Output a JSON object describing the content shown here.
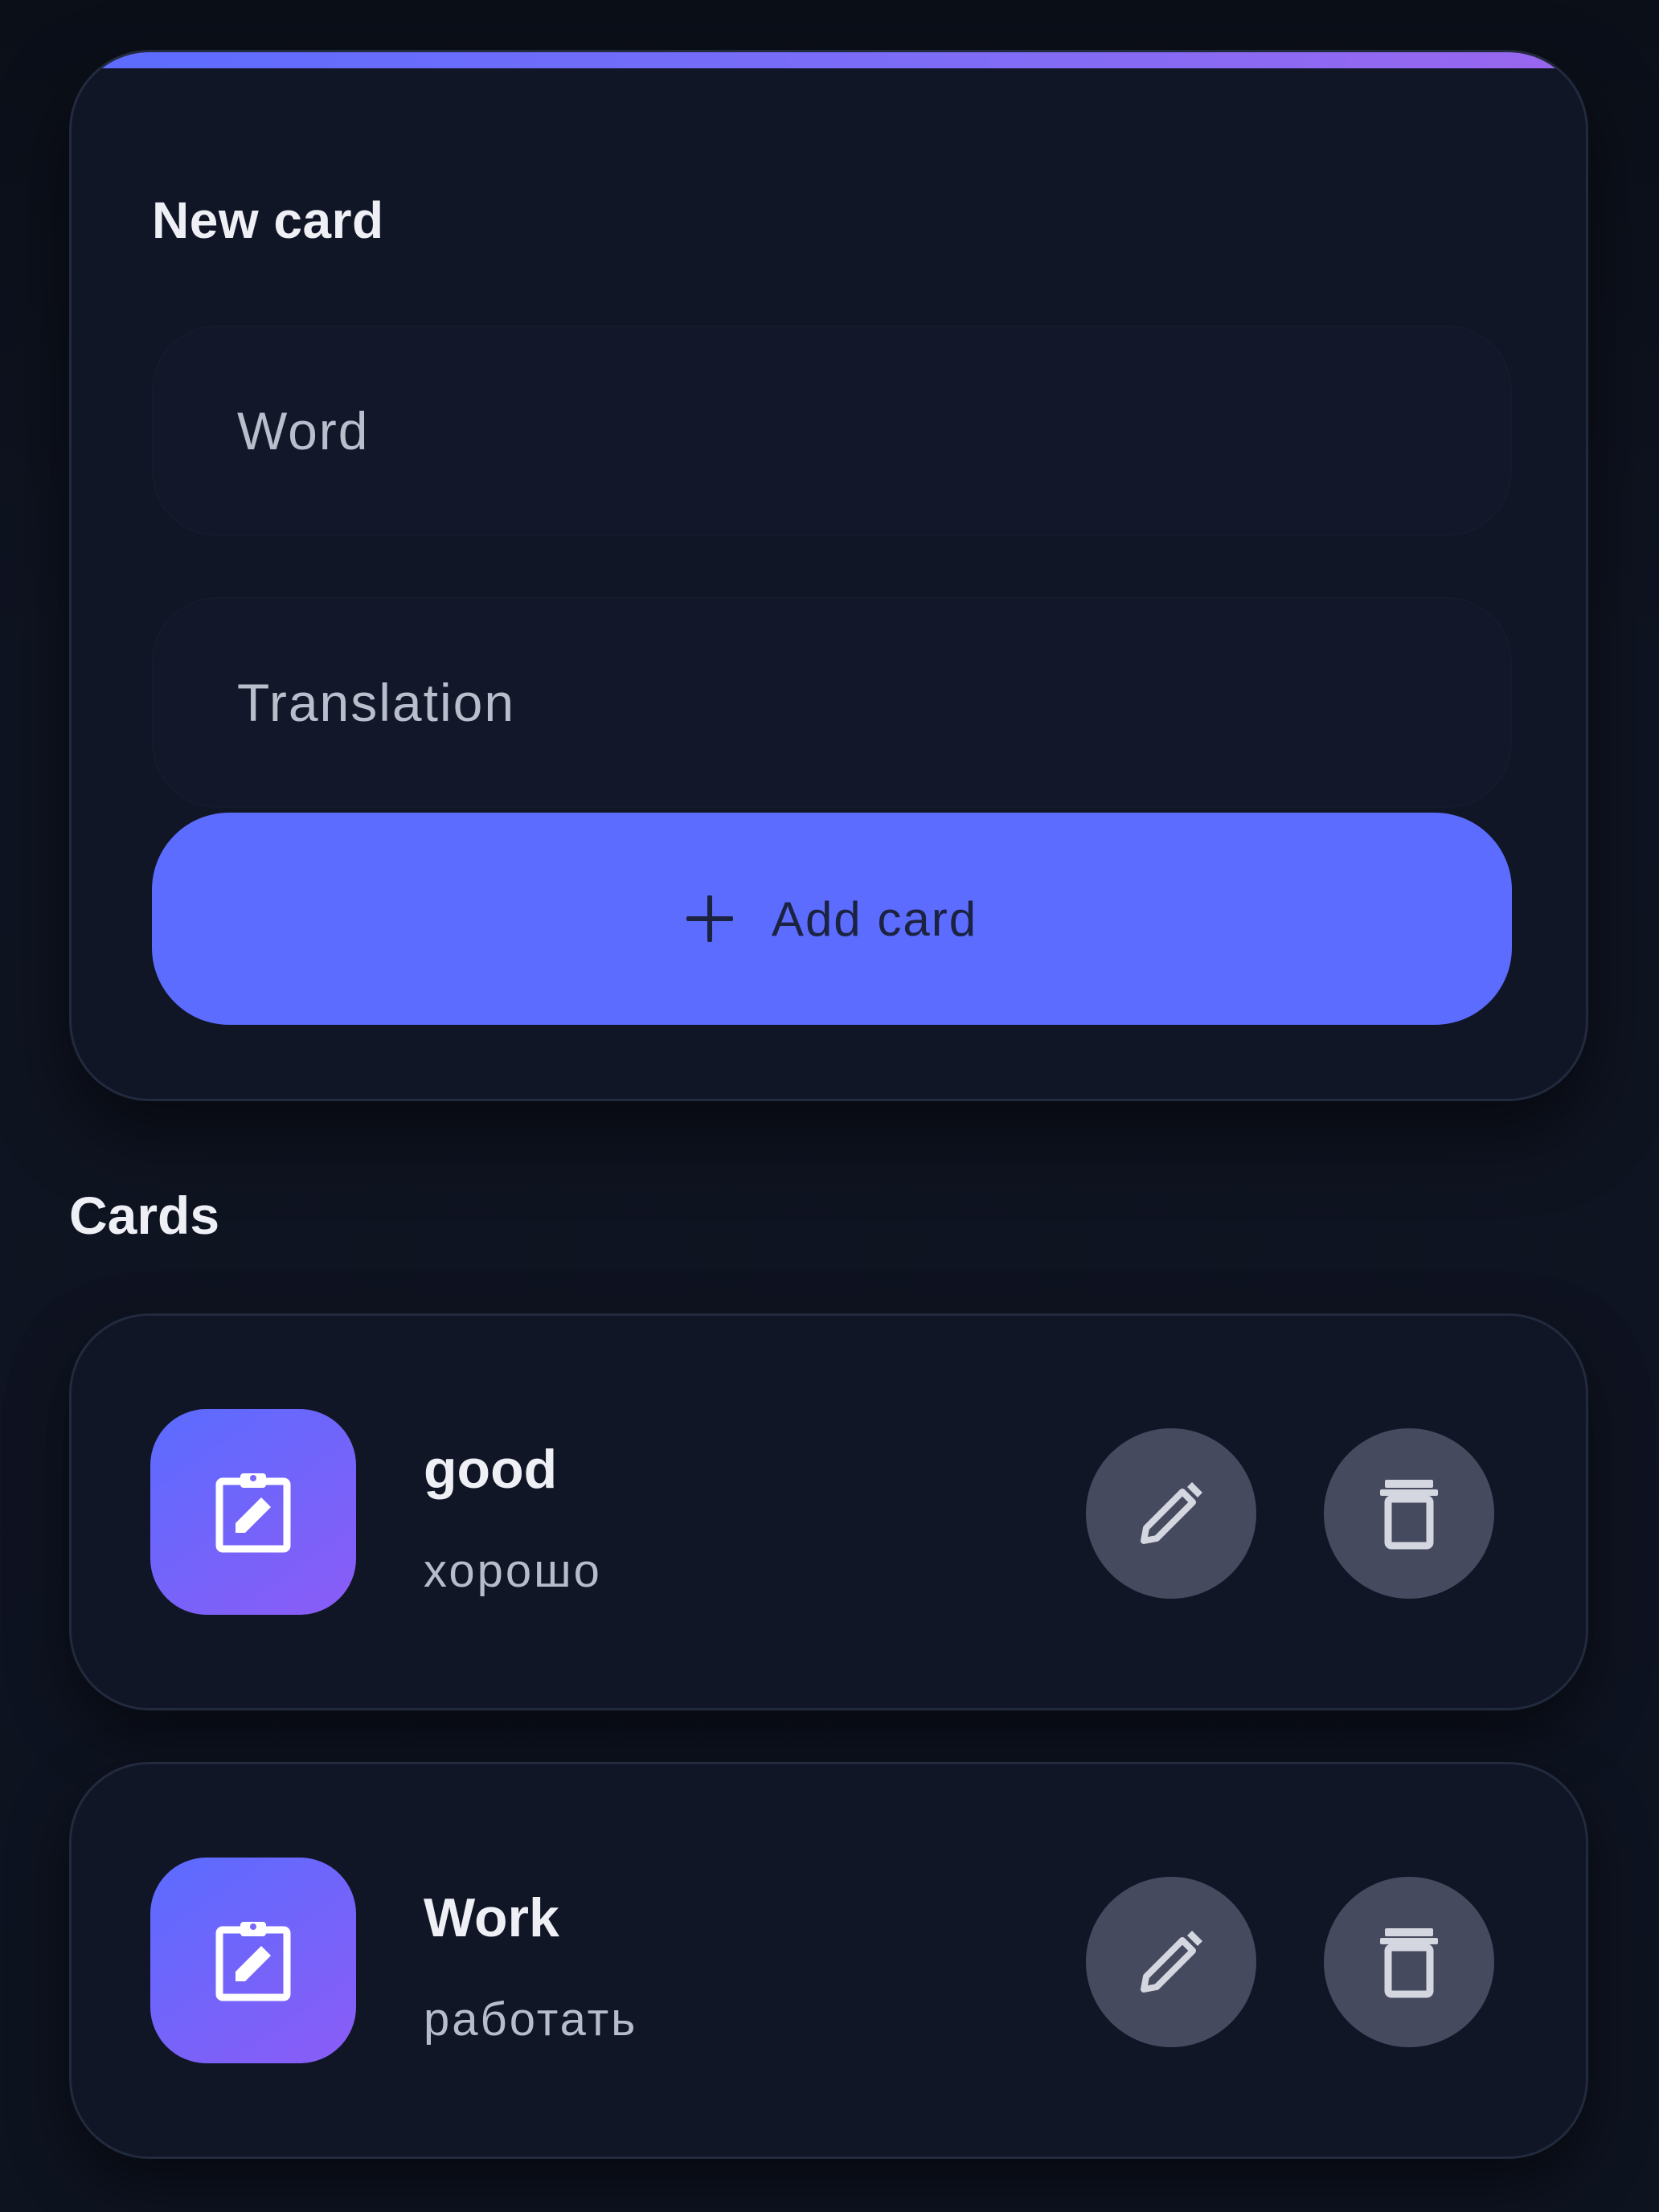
{
  "new_card": {
    "title": "New card",
    "word_placeholder": "Word",
    "translation_placeholder": "Translation",
    "add_button_label": "Add card",
    "add_button_icon": "plus-icon",
    "accent_color": "#5b6cff"
  },
  "cards_section": {
    "title": "Cards",
    "items": [
      {
        "word": "good",
        "translation": "хорошо",
        "icon": "clipboard-edit-icon"
      },
      {
        "word": "Work",
        "translation": "работать",
        "icon": "clipboard-edit-icon"
      }
    ],
    "edit_icon": "pencil-icon",
    "delete_icon": "trash-icon"
  },
  "colors": {
    "background": "#0e1320",
    "panel": "#111626",
    "primary": "#5b6cff",
    "avatar_gradient_end": "#8b5cf6",
    "icon_button": "#464a5e"
  }
}
